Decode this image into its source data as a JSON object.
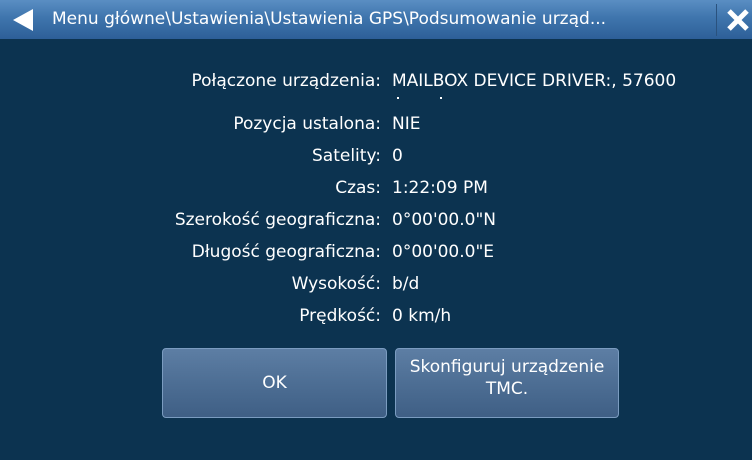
{
  "header": {
    "title": "Menu główne\\Ustawienia\\Ustawienia GPS\\Podsumowanie urząd..."
  },
  "icons": {
    "back": "back-arrow-icon",
    "close": "close-icon"
  },
  "summary": {
    "rows": [
      {
        "label": "Połączone urządzenia:",
        "value": "MAILBOX DEVICE DRIVER:, 57600"
      },
      {
        "label": "Pozycja ustalona:",
        "value": "NIE"
      },
      {
        "label": "Satelity:",
        "value": "0"
      },
      {
        "label": "Czas:",
        "value": "1:22:09 PM"
      },
      {
        "label": "Szerokość geograficzna:",
        "value": "0°00'00.0\"N"
      },
      {
        "label": "Długość geograficzna:",
        "value": "0°00'00.0\"E"
      },
      {
        "label": "Wysokość:",
        "value": "b/d"
      },
      {
        "label": "Prędkość:",
        "value": "0 km/h"
      }
    ]
  },
  "buttons": {
    "ok_label": "OK",
    "tmc_label": "Skonfiguruj urządzenie\nTMC."
  },
  "colors": {
    "background": "#0c3350",
    "titlebar": "#3f75ad",
    "button": "#4d6e94"
  }
}
